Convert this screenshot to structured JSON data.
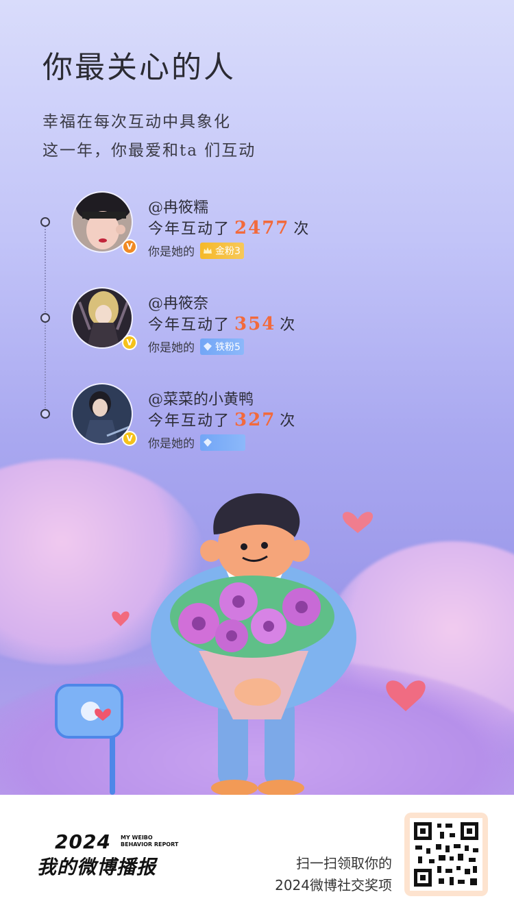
{
  "header": {
    "title": "你最关心的人",
    "subtitle_line1": "幸福在每次互动中具象化",
    "subtitle_line2": "这一年，你最爱和ta 们互动"
  },
  "people": [
    {
      "name": "@冉筱糯",
      "count_prefix": "今年互动了",
      "count": "2477",
      "count_suffix": "次",
      "relation": "你是她的",
      "fan_badge": "金粉3",
      "badge_color": "#f5b929",
      "verify_color": "#f08a24",
      "verify_icon": "v-icon"
    },
    {
      "name": "@冉筱奈",
      "count_prefix": "今年互动了",
      "count": "354",
      "count_suffix": "次",
      "relation": "你是她的",
      "fan_badge": "铁粉5",
      "badge_color": "#72a6f6",
      "verify_color": "#f5c21b",
      "verify_icon": "v-icon"
    },
    {
      "name": "@菜菜的小黄鸭",
      "count_prefix": "今年互动了",
      "count": "327",
      "count_suffix": "次",
      "relation": "你是她的",
      "fan_badge": "",
      "badge_color": "#72a6f6",
      "verify_color": "#f5c21b",
      "verify_icon": "v-icon"
    }
  ],
  "footer": {
    "brand_year": "2024",
    "brand_en_line1": "MY WEIBO",
    "brand_en_line2": "BEHAVIOR REPORT",
    "brand_cn": "我的微博播报",
    "scan_line1": "扫一扫领取你的",
    "scan_line2": "2024微博社交奖项"
  },
  "colors": {
    "accent_count": "#f26a3c",
    "text_dark": "#2d2d38"
  }
}
